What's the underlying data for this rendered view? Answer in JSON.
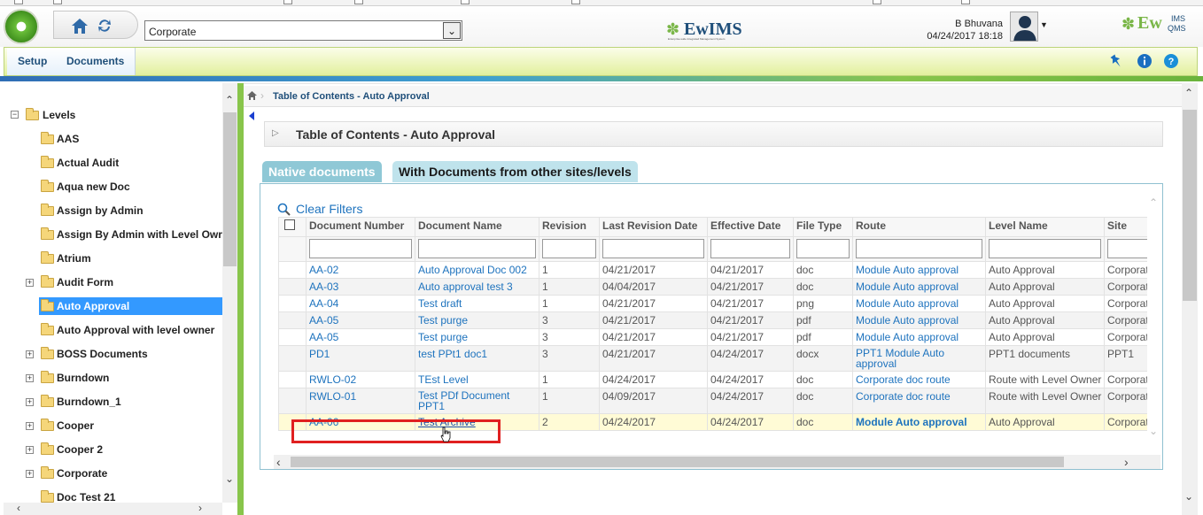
{
  "header": {
    "site_select": "Corporate",
    "brand_center": "EwIMS",
    "brand_center_tagline": "Enterprise-wide Integrated Management System",
    "user_name": "B Bhuvana",
    "user_datetime": "04/24/2017 18:18",
    "brand_right": "Ew",
    "brand_right_sup": "IMS",
    "brand_right_sub": "QMS"
  },
  "menu": {
    "items": [
      "Setup",
      "Documents"
    ]
  },
  "sidebar": {
    "root": "Levels",
    "items": [
      {
        "label": "AAS",
        "expandable": false,
        "selected": false
      },
      {
        "label": "Actual Audit",
        "expandable": false,
        "selected": false
      },
      {
        "label": "Aqua new Doc",
        "expandable": false,
        "selected": false
      },
      {
        "label": "Assign by Admin",
        "expandable": false,
        "selected": false
      },
      {
        "label": "Assign By Admin with Level Owr",
        "expandable": false,
        "selected": false
      },
      {
        "label": "Atrium",
        "expandable": false,
        "selected": false
      },
      {
        "label": "Audit Form",
        "expandable": true,
        "selected": false
      },
      {
        "label": "Auto Approval",
        "expandable": false,
        "selected": true
      },
      {
        "label": "Auto Approval with level owner",
        "expandable": false,
        "selected": false
      },
      {
        "label": "BOSS Documents",
        "expandable": true,
        "selected": false
      },
      {
        "label": "Burndown",
        "expandable": true,
        "selected": false
      },
      {
        "label": "Burndown_1",
        "expandable": true,
        "selected": false
      },
      {
        "label": "Cooper",
        "expandable": true,
        "selected": false
      },
      {
        "label": "Cooper 2",
        "expandable": true,
        "selected": false
      },
      {
        "label": "Corporate",
        "expandable": true,
        "selected": false
      },
      {
        "label": "Doc Test 21",
        "expandable": false,
        "selected": false
      }
    ]
  },
  "breadcrumb": {
    "text": "Table of Contents - Auto Approval"
  },
  "panel": {
    "title": "Table of Contents - Auto Approval"
  },
  "tabs": {
    "native": "Native documents",
    "other": "With Documents from other sites/levels"
  },
  "grid": {
    "clear_filters": "Clear Filters",
    "columns": [
      "Document Number",
      "Document Name",
      "Revision",
      "Last Revision Date",
      "Effective Date",
      "File Type",
      "Route",
      "Level Name",
      "Site"
    ],
    "rows": [
      [
        "AA-02",
        "Auto Approval Doc 002",
        "1",
        "04/21/2017",
        "04/21/2017",
        "doc",
        "Module Auto approval",
        "Auto Approval",
        "Corporate"
      ],
      [
        "AA-03",
        "Auto approval test 3",
        "1",
        "04/04/2017",
        "04/21/2017",
        "doc",
        "Module Auto approval",
        "Auto Approval",
        "Corporate"
      ],
      [
        "AA-04",
        "Test draft",
        "1",
        "04/21/2017",
        "04/21/2017",
        "png",
        "Module Auto approval",
        "Auto Approval",
        "Corporate"
      ],
      [
        "AA-05",
        "Test purge",
        "3",
        "04/21/2017",
        "04/21/2017",
        "pdf",
        "Module Auto approval",
        "Auto Approval",
        "Corporate"
      ],
      [
        "AA-05",
        "Test purge",
        "3",
        "04/21/2017",
        "04/21/2017",
        "pdf",
        "Module Auto approval",
        "Auto Approval",
        "Corporate"
      ],
      [
        "PD1",
        "test PPt1 doc1",
        "3",
        "04/21/2017",
        "04/24/2017",
        "docx",
        "PPT1 Module Auto approval",
        "PPT1 documents",
        "PPT1"
      ],
      [
        "RWLO-02",
        "TEst Level",
        "1",
        "04/24/2017",
        "04/24/2017",
        "doc",
        "Corporate doc route",
        "Route with Level Owner",
        "Corporate"
      ],
      [
        "RWLO-01",
        "Test PDf Document PPT1",
        "1",
        "04/09/2017",
        "04/24/2017",
        "doc",
        "Corporate doc route",
        "Route with Level Owner",
        "Corporate"
      ],
      [
        "AA-06",
        "Test Archive",
        "2",
        "04/24/2017",
        "04/24/2017",
        "doc",
        "Module Auto approval",
        "Auto Approval",
        "Corporate"
      ]
    ]
  }
}
